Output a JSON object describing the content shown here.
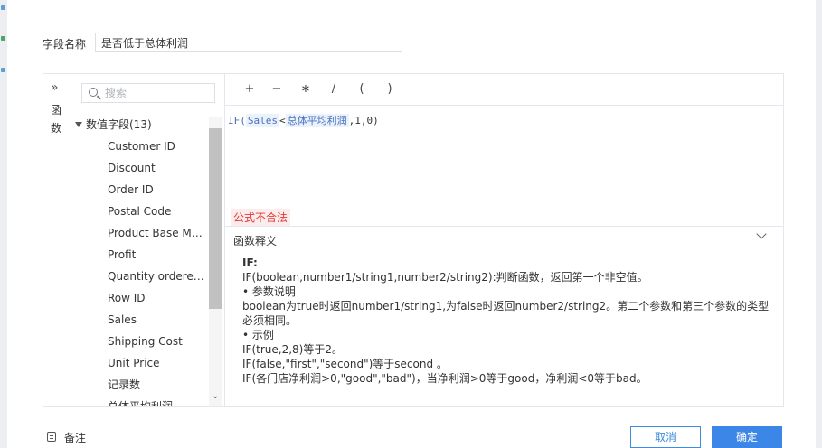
{
  "dialog": {
    "field_name_label": "字段名称",
    "field_name_value": "是否低于总体利润"
  },
  "sidebar_tab": {
    "toggle_glyph": "»",
    "label": "函数"
  },
  "field_list": {
    "search_placeholder": "搜索",
    "group_label": "数值字段(13)",
    "items": [
      "Customer ID",
      "Discount",
      "Order ID",
      "Postal Code",
      "Product Base Margin",
      "Profit",
      "Quantity ordered new",
      "Row ID",
      "Sales",
      "Shipping Cost",
      "Unit Price",
      "记录数",
      "总体平均利润"
    ]
  },
  "operators": [
    "+",
    "−",
    "∗",
    "/",
    "(",
    ")"
  ],
  "formula": {
    "prefix": "IF(",
    "field1": "Sales",
    "op": "<",
    "field2": "总体平均利润",
    "suffix": ",1,0)"
  },
  "error_text": "公式不合法",
  "explanation": {
    "header": "函数释义",
    "title": "IF:",
    "lines": [
      "IF(boolean,number1/string1,number2/string2):判断函数，返回第一个非空值。",
      "• 参数说明",
      "boolean为true时返回number1/string1,为false时返回number2/string2。第二个参数和第三个参数的类型必须相同。",
      "• 示例",
      "IF(true,2,8)等于2。",
      "IF(false,\"first\",\"second\")等于second 。",
      "IF(各门店净利润>0,\"good\",\"bad\")，当净利润>0等于good，净利润<0等于bad。"
    ]
  },
  "footer": {
    "note_label": "备注",
    "cancel_label": "取消",
    "ok_label": "确定"
  },
  "colors": {
    "primary": "#3b86e6",
    "error": "#e03a3a",
    "formula_token": "#4a6fbd"
  }
}
